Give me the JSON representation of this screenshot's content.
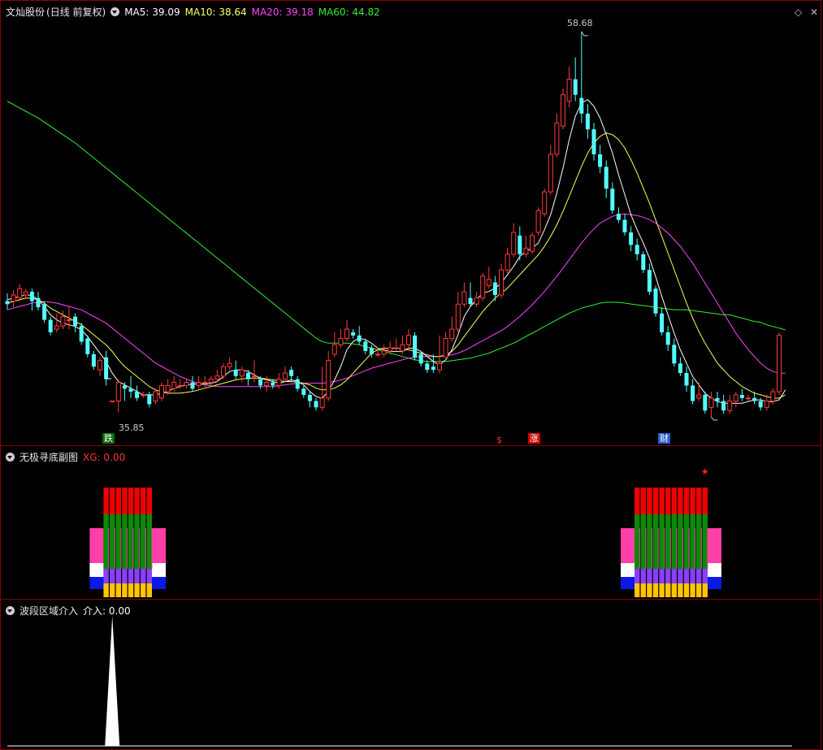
{
  "main": {
    "stock_name": "文灿股份",
    "period": "(日线 前复权)",
    "ma5_label": "MA5: 39.09",
    "ma10_label": "MA10: 38.64",
    "ma20_label": "MA20: 39.18",
    "ma60_label": "MA60: 44.82",
    "high_label": "58.68",
    "low_label": "35.85",
    "signal_die": "跌",
    "signal_s": "$",
    "signal_zhang": "涨",
    "signal_cai": "财",
    "colors": {
      "up": "#ff3b3b",
      "down": "#54ffff",
      "ma5": "#ffffff",
      "ma10": "#ffff55",
      "ma20": "#ff44ff",
      "ma60": "#33ee33"
    }
  },
  "sub1": {
    "title": "无极寻底副图",
    "xg_label": "XG: 0.00",
    "star": "★"
  },
  "sub2": {
    "title": "波段区域介入",
    "value_label": "介入: 0.00"
  },
  "chart_data": {
    "type": "candlestick",
    "candles": [
      [
        42.52,
        42.34,
        42.98,
        42.0
      ],
      [
        42.52,
        42.89,
        43.17,
        42.15
      ],
      [
        42.71,
        43.27,
        43.54,
        42.52
      ],
      [
        42.89,
        43.08,
        43.26,
        42.71
      ],
      [
        43.08,
        42.52,
        43.27,
        41.96
      ],
      [
        42.71,
        42.15,
        43.08,
        41.96
      ],
      [
        42.34,
        41.4,
        42.52,
        41.22
      ],
      [
        41.4,
        40.65,
        41.59,
        40.46
      ],
      [
        40.84,
        41.03,
        41.78,
        40.65
      ],
      [
        41.03,
        41.59,
        41.96,
        40.84
      ],
      [
        41.4,
        41.4,
        42.15,
        40.84
      ],
      [
        41.59,
        41.03,
        41.78,
        40.65
      ],
      [
        41.03,
        40.09,
        41.22,
        39.9
      ],
      [
        40.28,
        39.34,
        40.46,
        39.15
      ],
      [
        39.34,
        38.59,
        39.53,
        38.4
      ],
      [
        38.4,
        38.96,
        39.15,
        38.03
      ],
      [
        39.15,
        37.84,
        39.53,
        37.46
      ],
      [
        36.53,
        36.53,
        36.53,
        36.53
      ],
      [
        36.53,
        37.65,
        37.84,
        35.85
      ],
      [
        37.46,
        37.27,
        37.65,
        36.53
      ],
      [
        37.27,
        37.09,
        38.03,
        36.71
      ],
      [
        37.09,
        36.71,
        37.46,
        36.53
      ],
      [
        36.9,
        36.9,
        37.09,
        36.71
      ],
      [
        36.9,
        36.34,
        37.09,
        36.15
      ],
      [
        36.53,
        37.09,
        37.27,
        36.34
      ],
      [
        36.71,
        37.46,
        37.65,
        36.53
      ],
      [
        37.09,
        37.46,
        37.84,
        36.9
      ],
      [
        37.27,
        37.65,
        38.03,
        37.09
      ],
      [
        37.46,
        37.46,
        37.84,
        37.27
      ],
      [
        37.46,
        37.65,
        37.84,
        37.27
      ],
      [
        37.65,
        37.27,
        38.03,
        37.09
      ],
      [
        37.46,
        37.65,
        38.03,
        37.27
      ],
      [
        37.65,
        37.65,
        38.03,
        37.27
      ],
      [
        37.65,
        37.84,
        38.03,
        37.46
      ],
      [
        37.84,
        38.03,
        38.4,
        37.65
      ],
      [
        38.03,
        38.59,
        38.78,
        37.84
      ],
      [
        38.59,
        38.78,
        39.15,
        38.4
      ],
      [
        38.4,
        38.03,
        38.96,
        37.84
      ],
      [
        38.03,
        38.4,
        38.59,
        37.65
      ],
      [
        38.21,
        37.84,
        38.4,
        37.46
      ],
      [
        38.03,
        38.03,
        38.96,
        37.65
      ],
      [
        37.84,
        37.46,
        38.03,
        37.27
      ],
      [
        37.46,
        37.65,
        38.03,
        37.09
      ],
      [
        37.65,
        37.46,
        37.84,
        37.27
      ],
      [
        37.46,
        37.84,
        38.21,
        37.27
      ],
      [
        37.84,
        38.21,
        38.59,
        37.65
      ],
      [
        38.4,
        38.03,
        38.59,
        37.65
      ],
      [
        37.84,
        37.27,
        38.03,
        37.09
      ],
      [
        37.27,
        36.9,
        37.46,
        36.71
      ],
      [
        36.9,
        36.53,
        37.09,
        36.15
      ],
      [
        36.53,
        36.15,
        36.71,
        35.96
      ],
      [
        36.15,
        36.71,
        38.59,
        35.96
      ],
      [
        36.71,
        38.96,
        39.53,
        36.53
      ],
      [
        39.34,
        39.9,
        40.65,
        39.15
      ],
      [
        39.9,
        40.28,
        40.84,
        39.72
      ],
      [
        40.28,
        40.84,
        41.4,
        40.09
      ],
      [
        40.65,
        40.46,
        40.84,
        40.28
      ],
      [
        40.46,
        40.09,
        41.03,
        39.9
      ],
      [
        40.09,
        39.53,
        40.28,
        39.34
      ],
      [
        39.72,
        39.34,
        39.9,
        39.15
      ],
      [
        39.34,
        39.34,
        39.72,
        39.15
      ],
      [
        39.34,
        39.53,
        39.9,
        39.15
      ],
      [
        39.53,
        39.72,
        40.09,
        39.34
      ],
      [
        39.72,
        39.72,
        40.28,
        39.53
      ],
      [
        39.53,
        39.9,
        40.46,
        39.34
      ],
      [
        39.9,
        40.46,
        40.84,
        39.53
      ],
      [
        40.46,
        39.15,
        40.65,
        38.96
      ],
      [
        39.34,
        38.78,
        39.53,
        38.59
      ],
      [
        38.78,
        38.4,
        38.96,
        38.21
      ],
      [
        38.59,
        38.4,
        39.34,
        38.21
      ],
      [
        38.4,
        38.78,
        40.46,
        38.21
      ],
      [
        39.15,
        40.28,
        40.65,
        39.15
      ],
      [
        40.28,
        40.84,
        41.59,
        40.09
      ],
      [
        40.84,
        42.34,
        43.08,
        40.65
      ],
      [
        42.34,
        43.08,
        43.64,
        42.15
      ],
      [
        42.71,
        42.34,
        43.64,
        42.15
      ],
      [
        42.34,
        42.71,
        43.08,
        42.15
      ],
      [
        42.71,
        44.02,
        44.2,
        42.52
      ],
      [
        43.45,
        43.83,
        44.58,
        43.27
      ],
      [
        43.64,
        42.89,
        44.02,
        42.52
      ],
      [
        42.89,
        44.39,
        44.77,
        42.71
      ],
      [
        44.39,
        45.33,
        45.7,
        44.2
      ],
      [
        45.33,
        46.64,
        47.2,
        45.14
      ],
      [
        46.45,
        45.33,
        47.01,
        44.96
      ],
      [
        45.33,
        45.7,
        46.45,
        45.14
      ],
      [
        45.51,
        46.45,
        46.64,
        45.33
      ],
      [
        46.64,
        47.95,
        48.14,
        46.45
      ],
      [
        47.76,
        49.07,
        49.26,
        47.58
      ],
      [
        49.07,
        51.32,
        51.88,
        48.89
      ],
      [
        51.32,
        53.2,
        53.76,
        51.13
      ],
      [
        53.01,
        54.89,
        55.26,
        52.82
      ],
      [
        54.51,
        55.82,
        56.57,
        54.14
      ],
      [
        55.82,
        54.89,
        57.13,
        54.51
      ],
      [
        54.7,
        53.76,
        58.68,
        53.2
      ],
      [
        53.76,
        52.82,
        54.33,
        52.26
      ],
      [
        52.82,
        51.32,
        53.2,
        50.95
      ],
      [
        51.32,
        50.57,
        51.88,
        50.2
      ],
      [
        50.57,
        49.26,
        50.95,
        48.7
      ],
      [
        49.26,
        47.95,
        49.64,
        47.76
      ],
      [
        47.76,
        47.39,
        48.14,
        47.2
      ],
      [
        47.39,
        46.64,
        47.76,
        46.45
      ],
      [
        46.64,
        45.89,
        47.01,
        45.51
      ],
      [
        45.89,
        45.33,
        46.26,
        44.96
      ],
      [
        45.33,
        44.39,
        45.51,
        44.2
      ],
      [
        44.39,
        43.08,
        44.77,
        42.89
      ],
      [
        43.27,
        41.78,
        43.45,
        41.59
      ],
      [
        41.78,
        40.65,
        42.15,
        40.46
      ],
      [
        40.65,
        39.9,
        41.03,
        39.53
      ],
      [
        39.9,
        38.78,
        40.28,
        38.59
      ],
      [
        38.78,
        38.21,
        39.15,
        38.03
      ],
      [
        38.21,
        37.46,
        38.59,
        37.09
      ],
      [
        37.46,
        36.53,
        37.84,
        36.34
      ],
      [
        36.71,
        36.9,
        37.65,
        36.53
      ],
      [
        36.9,
        35.96,
        37.09,
        35.77
      ],
      [
        36.15,
        36.71,
        37.09,
        35.58
      ],
      [
        36.71,
        36.53,
        37.09,
        36.15
      ],
      [
        36.53,
        35.96,
        36.9,
        35.77
      ],
      [
        35.96,
        36.53,
        36.9,
        35.77
      ],
      [
        36.53,
        36.9,
        37.09,
        36.15
      ],
      [
        36.9,
        36.71,
        37.27,
        36.53
      ],
      [
        36.71,
        36.71,
        36.9,
        36.53
      ],
      [
        36.71,
        36.53,
        37.09,
        36.34
      ],
      [
        36.53,
        36.15,
        36.71,
        35.96
      ],
      [
        36.15,
        36.53,
        36.9,
        35.96
      ],
      [
        36.53,
        37.09,
        37.27,
        36.34
      ],
      [
        37.09,
        40.46,
        40.65,
        36.9
      ]
    ],
    "ma5": [
      42.6,
      42.7,
      42.8,
      42.9,
      42.85,
      42.6,
      42.2,
      41.7,
      41.4,
      41.2,
      41.1,
      41.0,
      40.8,
      40.4,
      39.9,
      39.4,
      38.9,
      38.2,
      37.7,
      37.5,
      37.3,
      37.1,
      36.9,
      36.9,
      36.9,
      37.0,
      37.1,
      37.3,
      37.4,
      37.5,
      37.55,
      37.55,
      37.55,
      37.6,
      37.7,
      38.0,
      38.3,
      38.4,
      38.4,
      38.3,
      38.1,
      37.9,
      37.8,
      37.7,
      37.6,
      37.7,
      37.8,
      37.7,
      37.5,
      37.1,
      36.8,
      36.7,
      37.1,
      37.8,
      38.6,
      39.6,
      40.1,
      40.3,
      40.2,
      40.0,
      39.7,
      39.6,
      39.5,
      39.5,
      39.5,
      39.7,
      39.7,
      39.5,
      39.2,
      38.9,
      38.7,
      39.0,
      39.6,
      40.5,
      41.6,
      42.2,
      42.6,
      43.0,
      43.1,
      43.3,
      43.6,
      44.1,
      44.6,
      45.2,
      45.5,
      45.7,
      46.0,
      46.8,
      47.7,
      49.0,
      50.5,
      52.2,
      53.6,
      54.4,
      54.6,
      54.2,
      53.5,
      52.5,
      51.4,
      50.1,
      48.9,
      47.7,
      46.8,
      46.0,
      45.1,
      44.0,
      42.8,
      41.7,
      40.6,
      39.6,
      38.8,
      38.0,
      37.5,
      37.0,
      36.7,
      36.5,
      36.4,
      36.4,
      36.4,
      36.4,
      36.5,
      36.6,
      36.6,
      36.5,
      36.5,
      36.6,
      37.2
    ],
    "ma10": [
      42.4,
      42.5,
      42.6,
      42.7,
      42.7,
      42.6,
      42.4,
      42.1,
      41.9,
      41.7,
      41.5,
      41.3,
      41.1,
      40.8,
      40.5,
      40.2,
      39.9,
      39.5,
      39.0,
      38.6,
      38.3,
      38.0,
      37.7,
      37.4,
      37.2,
      37.1,
      37.0,
      37.0,
      37.0,
      37.05,
      37.1,
      37.2,
      37.3,
      37.4,
      37.5,
      37.6,
      37.7,
      37.8,
      37.85,
      37.9,
      37.9,
      37.9,
      37.85,
      37.8,
      37.75,
      37.7,
      37.7,
      37.65,
      37.6,
      37.5,
      37.3,
      37.2,
      37.2,
      37.3,
      37.5,
      37.8,
      38.2,
      38.6,
      39.0,
      39.4,
      39.6,
      39.7,
      39.7,
      39.7,
      39.65,
      39.6,
      39.5,
      39.4,
      39.3,
      39.2,
      39.2,
      39.3,
      39.5,
      39.9,
      40.4,
      40.9,
      41.4,
      41.9,
      42.3,
      42.7,
      43.0,
      43.3,
      43.7,
      44.1,
      44.5,
      44.9,
      45.3,
      45.8,
      46.4,
      47.1,
      47.9,
      48.8,
      49.7,
      50.6,
      51.4,
      52.0,
      52.4,
      52.6,
      52.5,
      52.2,
      51.7,
      51.0,
      50.2,
      49.3,
      48.4,
      47.4,
      46.4,
      45.4,
      44.4,
      43.4,
      42.4,
      41.5,
      40.7,
      40.0,
      39.4,
      38.8,
      38.4,
      38.0,
      37.7,
      37.4,
      37.2,
      37.0,
      36.9,
      36.8,
      36.7,
      36.7,
      36.9
    ],
    "ma20": [
      42.0,
      42.1,
      42.2,
      42.3,
      42.4,
      42.45,
      42.5,
      42.45,
      42.4,
      42.3,
      42.2,
      42.1,
      42.0,
      41.8,
      41.6,
      41.4,
      41.2,
      40.9,
      40.6,
      40.3,
      40.0,
      39.7,
      39.4,
      39.1,
      38.8,
      38.6,
      38.4,
      38.2,
      38.0,
      37.85,
      37.7,
      37.6,
      37.5,
      37.45,
      37.4,
      37.4,
      37.4,
      37.4,
      37.4,
      37.4,
      37.4,
      37.4,
      37.4,
      37.4,
      37.45,
      37.5,
      37.55,
      37.6,
      37.6,
      37.6,
      37.6,
      37.6,
      37.65,
      37.7,
      37.8,
      37.9,
      38.05,
      38.2,
      38.35,
      38.5,
      38.6,
      38.7,
      38.8,
      38.9,
      39.0,
      39.1,
      39.15,
      39.2,
      39.2,
      39.2,
      39.2,
      39.25,
      39.3,
      39.4,
      39.55,
      39.75,
      39.95,
      40.15,
      40.35,
      40.55,
      40.75,
      41.0,
      41.3,
      41.6,
      41.95,
      42.3,
      42.7,
      43.1,
      43.55,
      44.0,
      44.5,
      45.0,
      45.5,
      46.0,
      46.45,
      46.85,
      47.2,
      47.4,
      47.6,
      47.7,
      47.75,
      47.7,
      47.65,
      47.55,
      47.4,
      47.2,
      46.9,
      46.6,
      46.2,
      45.8,
      45.3,
      44.8,
      44.2,
      43.6,
      43.0,
      42.4,
      41.8,
      41.2,
      40.6,
      40.1,
      39.6,
      39.2,
      38.8,
      38.5,
      38.3,
      38.2,
      38.2
    ],
    "ma60": [
      54.5,
      54.3,
      54.1,
      53.9,
      53.7,
      53.5,
      53.25,
      53.0,
      52.75,
      52.5,
      52.25,
      52.0,
      51.7,
      51.4,
      51.1,
      50.8,
      50.5,
      50.2,
      49.9,
      49.6,
      49.3,
      49.0,
      48.7,
      48.4,
      48.1,
      47.8,
      47.5,
      47.2,
      46.9,
      46.6,
      46.3,
      46.0,
      45.7,
      45.4,
      45.1,
      44.8,
      44.5,
      44.2,
      43.9,
      43.6,
      43.3,
      43.0,
      42.7,
      42.4,
      42.1,
      41.8,
      41.5,
      41.2,
      40.9,
      40.6,
      40.3,
      40.1,
      40.0,
      40.0,
      40.0,
      40.0,
      39.95,
      39.9,
      39.8,
      39.7,
      39.6,
      39.5,
      39.4,
      39.3,
      39.2,
      39.1,
      39.0,
      38.95,
      38.9,
      38.9,
      38.9,
      38.9,
      38.95,
      39.0,
      39.05,
      39.1,
      39.2,
      39.3,
      39.4,
      39.55,
      39.7,
      39.85,
      40.0,
      40.2,
      40.4,
      40.6,
      40.8,
      41.0,
      41.2,
      41.4,
      41.6,
      41.8,
      41.95,
      42.1,
      42.2,
      42.3,
      42.4,
      42.45,
      42.45,
      42.45,
      42.4,
      42.35,
      42.3,
      42.25,
      42.2,
      42.15,
      42.1,
      42.05,
      42.0,
      42.0,
      42.0,
      41.95,
      41.9,
      41.85,
      41.8,
      41.75,
      41.7,
      41.7,
      41.6,
      41.5,
      41.4,
      41.3,
      41.25,
      41.1,
      41.0,
      40.9,
      40.8
    ],
    "ylim": [
      34.9,
      59.5
    ],
    "sub1_signal_ranges": [
      [
        16,
        23
      ],
      [
        102,
        113
      ]
    ],
    "sub2_peak": {
      "x_index": 17,
      "value": 1
    }
  }
}
